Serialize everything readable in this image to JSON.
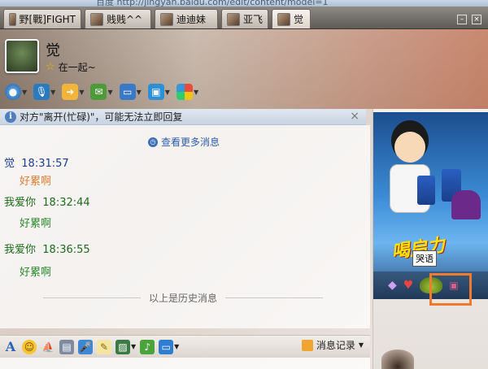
{
  "browser": {
    "url_fragment": "百度 http://jingyan.baidu.com/edit/content/model=1"
  },
  "tabs": [
    {
      "label": "野[戰]FIGHT",
      "active": false
    },
    {
      "label": "贱贱^^",
      "active": false
    },
    {
      "label": "迪迪妹",
      "active": false
    },
    {
      "label": "亚飞",
      "active": false
    },
    {
      "label": "觉",
      "active": true
    }
  ],
  "header": {
    "contact_name": "觉",
    "status_text": "在一起~",
    "toolbar_icons": [
      "video-call-icon",
      "voice-call-icon",
      "send-file-icon",
      "sms-icon",
      "remote-desktop-icon",
      "screen-share-icon",
      "apps-icon"
    ]
  },
  "notice": {
    "text": "对方\"离开(忙碌)\"，可能无法立即回复",
    "close": "×"
  },
  "chat": {
    "more_messages": "查看更多消息",
    "messages": [
      {
        "sender": "觉",
        "time": "18:31:57",
        "text": "好累啊"
      },
      {
        "sender": "我爱你",
        "time": "18:32:44",
        "text": "好累啊"
      },
      {
        "sender": "我爱你",
        "time": "18:36:55",
        "text": "好累啊"
      }
    ],
    "history_divider": "以上是历史消息"
  },
  "input_toolbar": {
    "font_button": "A",
    "history_label": "消息记录"
  },
  "side_panel": {
    "ad_text": "喝启力",
    "ad_tag": "哭语"
  },
  "colors": {
    "accent_blue": "#2e5ea8",
    "highlight_orange": "#f07a2e",
    "other_name": "#1c3d8f",
    "self_name": "#1d6b1d"
  }
}
